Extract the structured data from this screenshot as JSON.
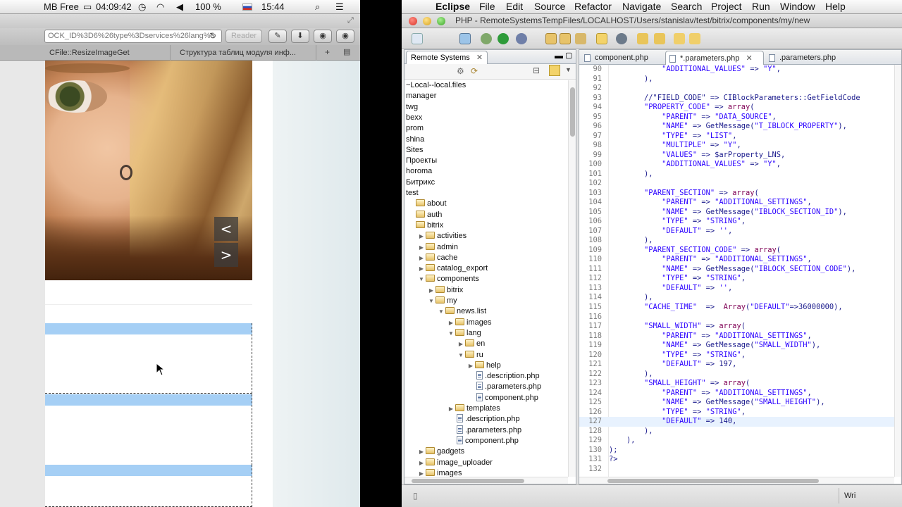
{
  "safari": {
    "menubar": {
      "left_fragment": "MB Free",
      "battery_icon": "battery-icon",
      "time_short": "04:09:42",
      "battery_percent": "100 %",
      "clock": "15:44"
    },
    "url": "OCK_ID%3D6%26type%3Dservices%26lang%3",
    "reader_label": "Reader",
    "tabs": [
      {
        "label": "CFile::ResizeImageGet"
      },
      {
        "label": "Структура таблиц модуля инф..."
      }
    ],
    "slider_prev": "<",
    "slider_next": ">"
  },
  "eclipse": {
    "menubar": {
      "app_name": "Eclipse",
      "items": [
        "File",
        "Edit",
        "Source",
        "Refactor",
        "Navigate",
        "Search",
        "Project",
        "Run",
        "Window",
        "Help"
      ]
    },
    "window_title": "PHP - RemoteSystemsTempFiles/LOCALHOST/Users/stanislav/test/bitrix/components/my/new",
    "remote_systems": {
      "tab_label": "Remote Systems",
      "tree": [
        {
          "label": "~Local--local.files",
          "kind": "text",
          "depth": 0
        },
        {
          "label": "manager",
          "kind": "text",
          "depth": 0
        },
        {
          "label": "twg",
          "kind": "text",
          "depth": 0
        },
        {
          "label": "bexx",
          "kind": "text",
          "depth": 0
        },
        {
          "label": "prom",
          "kind": "text",
          "depth": 0
        },
        {
          "label": "shina",
          "kind": "text",
          "depth": 0
        },
        {
          "label": "Sites",
          "kind": "text",
          "depth": 0
        },
        {
          "label": "Проекты",
          "kind": "text",
          "depth": 0
        },
        {
          "label": "horoma",
          "kind": "text",
          "depth": 0
        },
        {
          "label": "Битрикс",
          "kind": "text",
          "depth": 0
        },
        {
          "label": "test",
          "kind": "text",
          "depth": 0
        },
        {
          "label": "about",
          "kind": "folder",
          "depth": 0,
          "twisty": ""
        },
        {
          "label": "auth",
          "kind": "folder",
          "depth": 0,
          "twisty": ""
        },
        {
          "label": "bitrix",
          "kind": "folder",
          "depth": 0,
          "twisty": ""
        },
        {
          "label": "activities",
          "kind": "folder",
          "depth": 1,
          "twisty": "▶"
        },
        {
          "label": "admin",
          "kind": "folder",
          "depth": 1,
          "twisty": "▶"
        },
        {
          "label": "cache",
          "kind": "folder",
          "depth": 1,
          "twisty": "▶"
        },
        {
          "label": "catalog_export",
          "kind": "folder",
          "depth": 1,
          "twisty": "▶"
        },
        {
          "label": "components",
          "kind": "folder",
          "depth": 1,
          "twisty": "▼"
        },
        {
          "label": "bitrix",
          "kind": "folder",
          "depth": 2,
          "twisty": "▶"
        },
        {
          "label": "my",
          "kind": "folder",
          "depth": 2,
          "twisty": "▼"
        },
        {
          "label": "news.list",
          "kind": "folder",
          "depth": 3,
          "twisty": "▼"
        },
        {
          "label": "images",
          "kind": "folder",
          "depth": 4,
          "twisty": "▶"
        },
        {
          "label": "lang",
          "kind": "folder",
          "depth": 4,
          "twisty": "▼"
        },
        {
          "label": "en",
          "kind": "folder",
          "depth": 5,
          "twisty": "▶"
        },
        {
          "label": "ru",
          "kind": "folder",
          "depth": 5,
          "twisty": "▼"
        },
        {
          "label": "help",
          "kind": "folder",
          "depth": 6,
          "twisty": "▶"
        },
        {
          "label": ".description.php",
          "kind": "file",
          "depth": 6,
          "twisty": ""
        },
        {
          "label": ".parameters.php",
          "kind": "file",
          "depth": 6,
          "twisty": ""
        },
        {
          "label": "component.php",
          "kind": "file",
          "depth": 6,
          "twisty": ""
        },
        {
          "label": "templates",
          "kind": "folder",
          "depth": 4,
          "twisty": "▶"
        },
        {
          "label": ".description.php",
          "kind": "file",
          "depth": 4,
          "twisty": ""
        },
        {
          "label": ".parameters.php",
          "kind": "file",
          "depth": 4,
          "twisty": ""
        },
        {
          "label": "component.php",
          "kind": "file",
          "depth": 4,
          "twisty": ""
        },
        {
          "label": "gadgets",
          "kind": "folder",
          "depth": 1,
          "twisty": "▶"
        },
        {
          "label": "image_uploader",
          "kind": "folder",
          "depth": 1,
          "twisty": "▶"
        },
        {
          "label": "images",
          "kind": "folder",
          "depth": 1,
          "twisty": "▶"
        }
      ]
    },
    "editor": {
      "tabs": [
        {
          "label": "component.php",
          "active": false
        },
        {
          "label": ".parameters.php",
          "active": true,
          "dirty_prefix": "*"
        },
        {
          "label": ".parameters.php",
          "active": false
        }
      ],
      "lines": [
        {
          "n": "90",
          "t": "            \"ADDITIONAL_VALUES\" => \"Y\","
        },
        {
          "n": "91",
          "t": "        ),"
        },
        {
          "n": "92",
          "t": ""
        },
        {
          "n": "93",
          "t": "        //\"FIELD_CODE\" => CIBlockParameters::GetFieldCode"
        },
        {
          "n": "94",
          "t": "        \"PROPERTY_CODE\" => array("
        },
        {
          "n": "95",
          "t": "            \"PARENT\" => \"DATA_SOURCE\","
        },
        {
          "n": "96",
          "t": "            \"NAME\" => GetMessage(\"T_IBLOCK_PROPERTY\"),"
        },
        {
          "n": "97",
          "t": "            \"TYPE\" => \"LIST\","
        },
        {
          "n": "98",
          "t": "            \"MULTIPLE\" => \"Y\","
        },
        {
          "n": "99",
          "t": "            \"VALUES\" => $arProperty_LNS,"
        },
        {
          "n": "100",
          "t": "            \"ADDITIONAL_VALUES\" => \"Y\","
        },
        {
          "n": "101",
          "t": "        ),"
        },
        {
          "n": "102",
          "t": ""
        },
        {
          "n": "103",
          "t": "        \"PARENT_SECTION\" => array("
        },
        {
          "n": "104",
          "t": "            \"PARENT\" => \"ADDITIONAL_SETTINGS\","
        },
        {
          "n": "105",
          "t": "            \"NAME\" => GetMessage(\"IBLOCK_SECTION_ID\"),"
        },
        {
          "n": "106",
          "t": "            \"TYPE\" => \"STRING\","
        },
        {
          "n": "107",
          "t": "            \"DEFAULT\" => '',"
        },
        {
          "n": "108",
          "t": "        ),"
        },
        {
          "n": "109",
          "t": "        \"PARENT_SECTION_CODE\" => array("
        },
        {
          "n": "110",
          "t": "            \"PARENT\" => \"ADDITIONAL_SETTINGS\","
        },
        {
          "n": "111",
          "t": "            \"NAME\" => GetMessage(\"IBLOCK_SECTION_CODE\"),"
        },
        {
          "n": "112",
          "t": "            \"TYPE\" => \"STRING\","
        },
        {
          "n": "113",
          "t": "            \"DEFAULT\" => '',"
        },
        {
          "n": "114",
          "t": "        ),"
        },
        {
          "n": "115",
          "t": "        \"CACHE_TIME\"  =>  Array(\"DEFAULT\"=>36000000),"
        },
        {
          "n": "116",
          "t": ""
        },
        {
          "n": "117",
          "t": "        \"SMALL_WIDTH\" => array("
        },
        {
          "n": "118",
          "t": "            \"PARENT\" => \"ADDITIONAL_SETTINGS\","
        },
        {
          "n": "119",
          "t": "            \"NAME\" => GetMessage(\"SMALL_WIDTH\"),"
        },
        {
          "n": "120",
          "t": "            \"TYPE\" => \"STRING\","
        },
        {
          "n": "121",
          "t": "            \"DEFAULT\" => 197,"
        },
        {
          "n": "122",
          "t": "        ),"
        },
        {
          "n": "123",
          "t": "        \"SMALL_HEIGHT\" => array("
        },
        {
          "n": "124",
          "t": "            \"PARENT\" => \"ADDITIONAL_SETTINGS\","
        },
        {
          "n": "125",
          "t": "            \"NAME\" => GetMessage(\"SMALL_HEIGHT\"),"
        },
        {
          "n": "126",
          "t": "            \"TYPE\" => \"STRING\","
        },
        {
          "n": "127",
          "t": "            \"DEFAULT\" => 140,",
          "highlight": true
        },
        {
          "n": "128",
          "t": "        ),"
        },
        {
          "n": "129",
          "t": "    ),"
        },
        {
          "n": "130",
          "t": ");"
        },
        {
          "n": "131",
          "t": "?>"
        },
        {
          "n": "132",
          "t": ""
        }
      ]
    },
    "status": {
      "write_mode": "Wri"
    }
  }
}
